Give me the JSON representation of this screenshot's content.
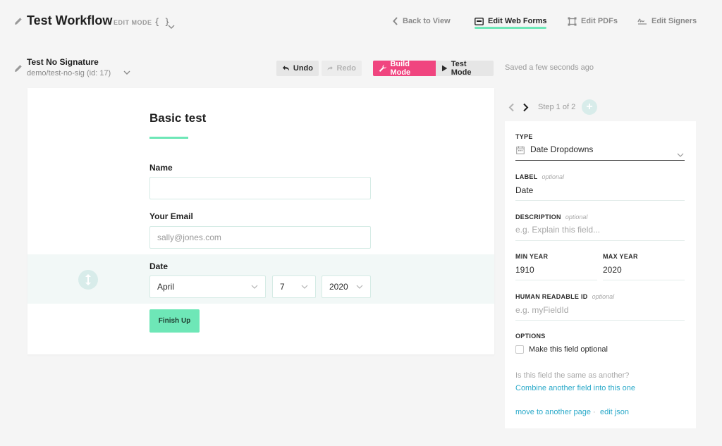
{
  "header": {
    "workflow_title": "Test Workflow",
    "edit_mode_label": "EDIT MODE",
    "json_braces": "{ }",
    "nav": [
      {
        "label": "Back to View",
        "icon": "chevron-left-icon"
      },
      {
        "label": "Edit Web Forms",
        "icon": "web-form-icon",
        "active": true
      },
      {
        "label": "Edit PDFs",
        "icon": "pdf-frame-icon"
      },
      {
        "label": "Edit Signers",
        "icon": "signature-icon"
      }
    ]
  },
  "form_meta": {
    "name": "Test No Signature",
    "path": "demo/test-no-sig (id: 17)"
  },
  "toolbar": {
    "undo": "Undo",
    "redo": "Redo",
    "build_mode": "Build Mode",
    "test_mode": "Test Mode",
    "saved_status": "Saved a few seconds ago"
  },
  "form": {
    "title": "Basic test",
    "fields": {
      "name_label": "Name",
      "name_value": "",
      "email_label": "Your Email",
      "email_placeholder": "sally@jones.com",
      "date_label": "Date",
      "month": "April",
      "day": "7",
      "year": "2020"
    },
    "finish_button": "Finish Up"
  },
  "steps": {
    "text": "Step 1 of 2",
    "add_symbol": "+"
  },
  "panel": {
    "type_label": "TYPE",
    "type_value": "Date Dropdowns",
    "label_label": "LABEL",
    "optional": "optional",
    "label_value": "Date",
    "description_label": "DESCRIPTION",
    "description_placeholder": "e.g. Explain this field...",
    "min_year_label": "MIN YEAR",
    "min_year_value": "1910",
    "max_year_label": "MAX YEAR",
    "max_year_value": "2020",
    "human_id_label": "HUMAN READABLE ID",
    "human_id_placeholder": "e.g. myFieldId",
    "options_label": "OPTIONS",
    "make_optional_label": "Make this field optional",
    "same_question": "Is this field the same as another?",
    "combine_link": "Combine another field into this one",
    "move_link": "move to another page",
    "separator": "·",
    "edit_json_link": "edit json"
  },
  "colors": {
    "accent_green": "#6ee7b7",
    "build_pink": "#f0457f",
    "link_blue": "#2aa9c9"
  }
}
